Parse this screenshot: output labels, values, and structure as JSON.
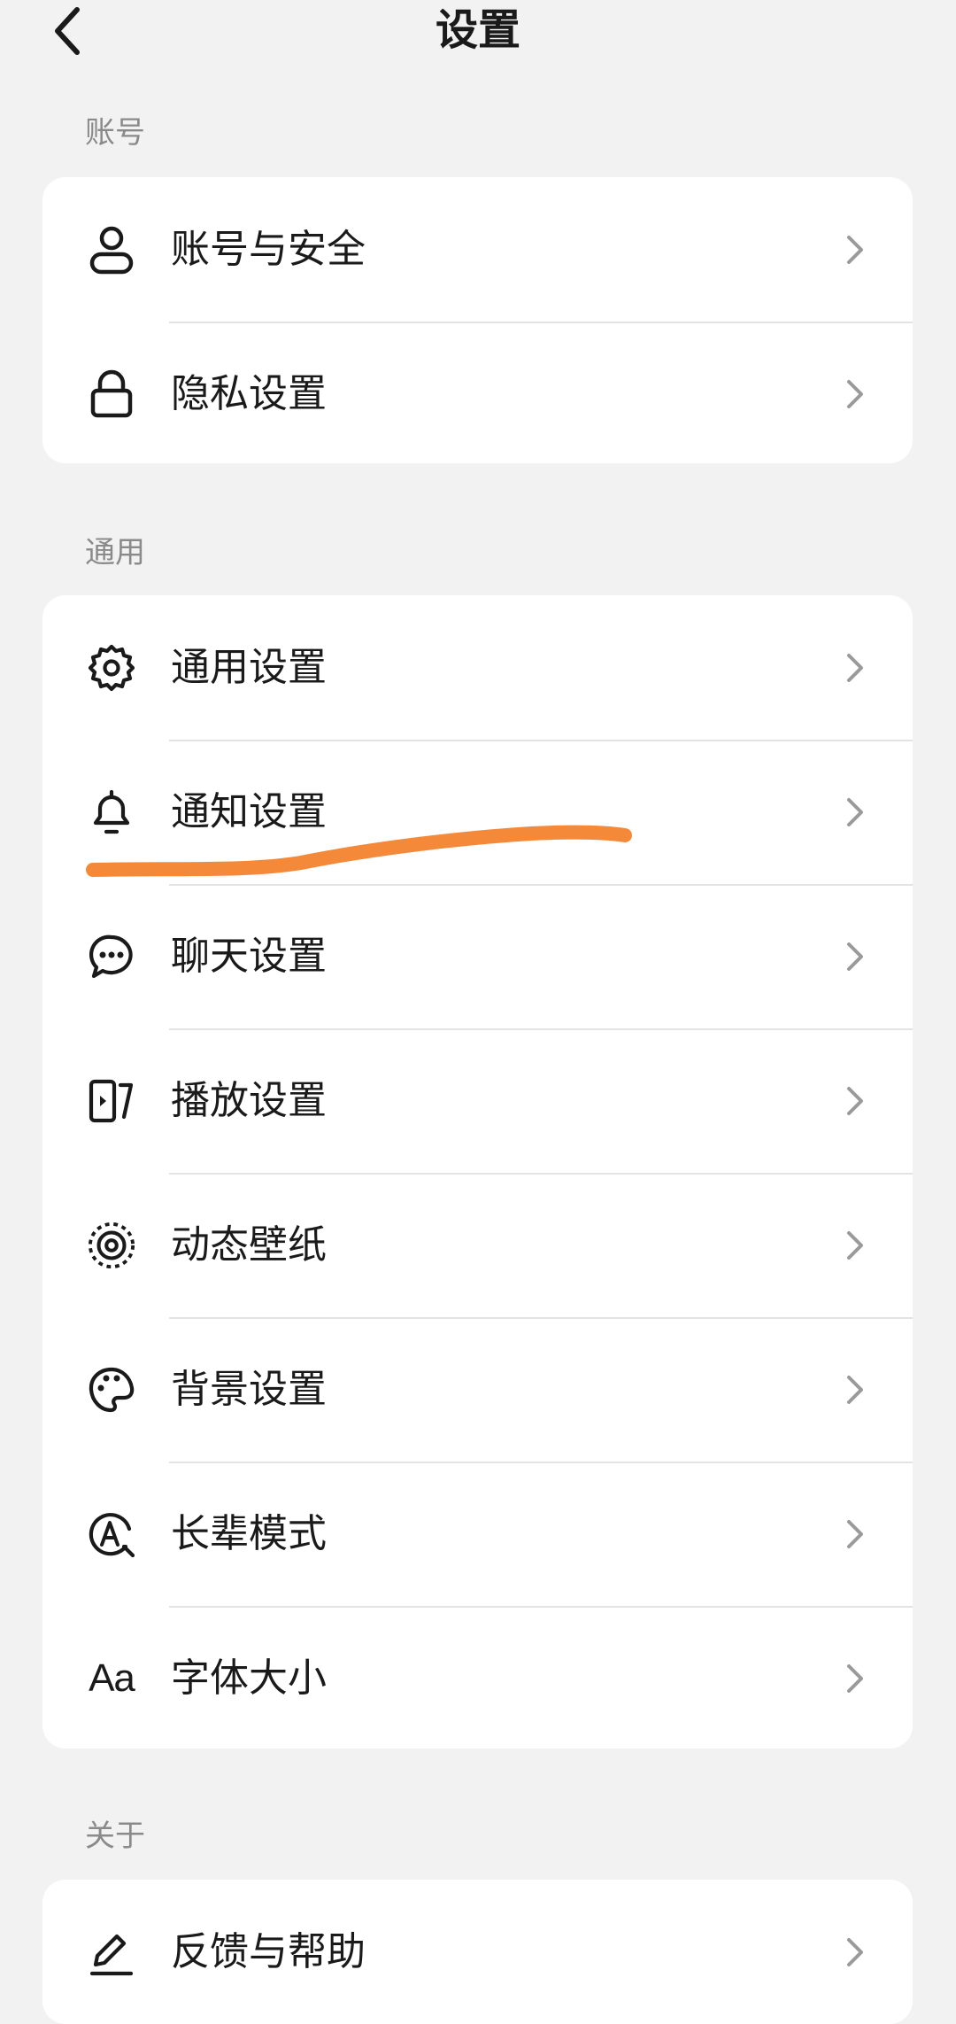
{
  "header": {
    "title": "设置"
  },
  "sections": [
    {
      "label": "账号",
      "items": [
        {
          "label": "账号与安全",
          "icon": "user-icon"
        },
        {
          "label": "隐私设置",
          "icon": "lock-icon"
        }
      ]
    },
    {
      "label": "通用",
      "items": [
        {
          "label": "通用设置",
          "icon": "gear-icon"
        },
        {
          "label": "通知设置",
          "icon": "bell-icon"
        },
        {
          "label": "聊天设置",
          "icon": "chat-bubble-icon"
        },
        {
          "label": "播放设置",
          "icon": "play-settings-icon"
        },
        {
          "label": "动态壁纸",
          "icon": "live-wallpaper-icon"
        },
        {
          "label": "背景设置",
          "icon": "palette-icon"
        },
        {
          "label": "长辈模式",
          "icon": "elder-mode-icon"
        },
        {
          "label": "字体大小",
          "icon": "font-size-icon",
          "icon_text": "Aa"
        }
      ]
    },
    {
      "label": "关于",
      "items": [
        {
          "label": "反馈与帮助",
          "icon": "pencil-icon"
        }
      ]
    }
  ],
  "colors": {
    "background": "#f2f2f2",
    "card": "#ffffff",
    "text": "#1a1a1a",
    "section_label": "#8a8a8a",
    "chevron": "#9a9a9a",
    "annotation_stroke": "#f5893a"
  }
}
